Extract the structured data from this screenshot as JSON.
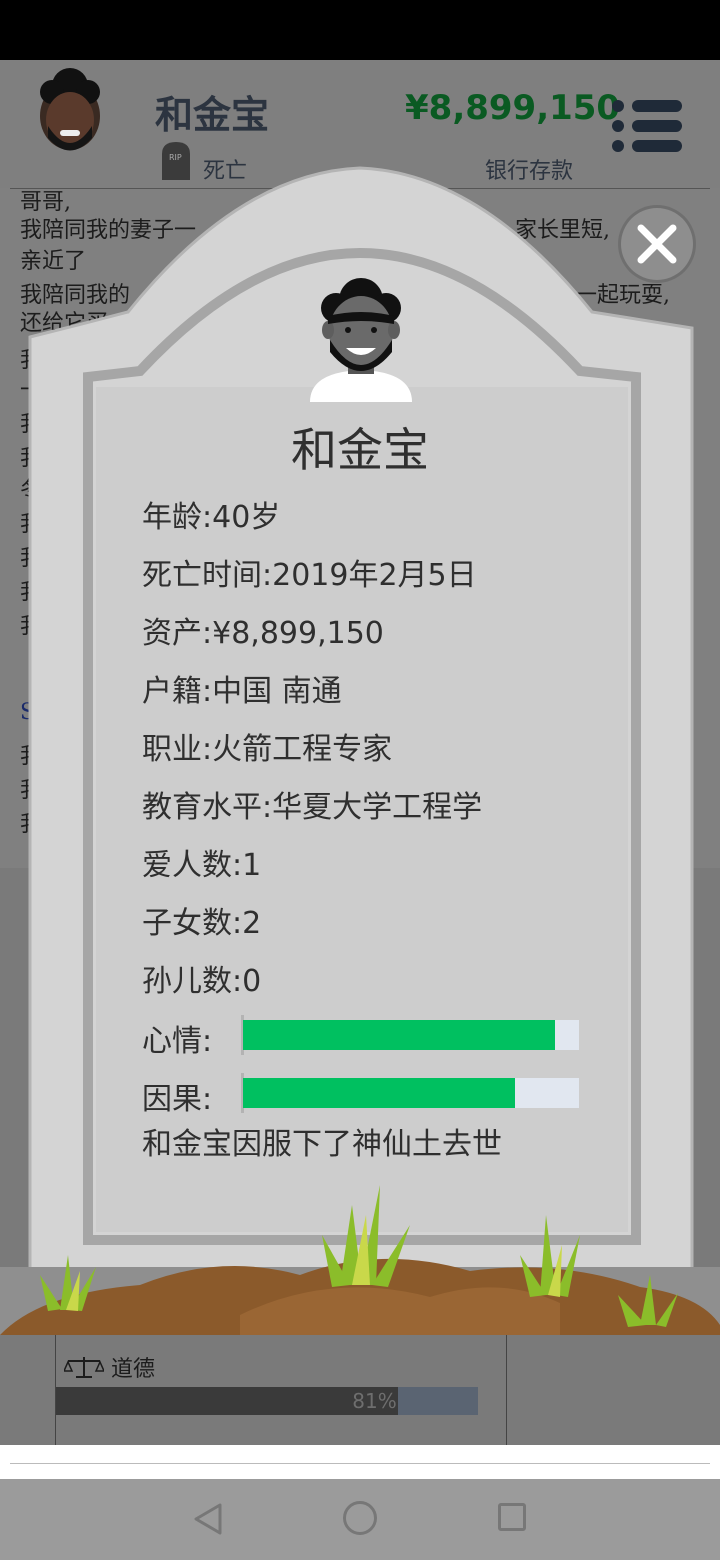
{
  "header": {
    "name": "和金宝",
    "status": "死亡",
    "money": "¥8,899,150",
    "money_label": "银行存款"
  },
  "log": [
    "哥哥,",
    "我陪同我的妻子一",
    "家长里短,",
    "亲近了",
    "我陪同我的",
    "一起玩耍,",
    "还给它买",
    "我",
    "一",
    "我",
    "我",
    "冬",
    "我",
    "我",
    "我",
    "我",
    "S",
    "我",
    "我",
    "我"
  ],
  "moral": {
    "label": "道德",
    "percent_text": "81%",
    "value": 0.81
  },
  "tombstone": {
    "name": "和金宝",
    "rows": [
      {
        "label": "年龄:",
        "value": "40岁"
      },
      {
        "label": "死亡时间:",
        "value": "2019年2月5日"
      },
      {
        "label": "资产:",
        "value": "¥8,899,150"
      },
      {
        "label": "户籍:",
        "value": "中国 南通"
      },
      {
        "label": "职业:",
        "value": "火箭工程专家"
      },
      {
        "label": "教育水平:",
        "value": "华夏大学工程学"
      },
      {
        "label": "爱人数:",
        "value": "1"
      },
      {
        "label": "子女数:",
        "value": "2"
      },
      {
        "label": "孙儿数:",
        "value": "0"
      }
    ],
    "mood": {
      "label": "心情:",
      "value": 0.93
    },
    "karma": {
      "label": "因果:",
      "value": 0.81
    },
    "epitaph": "和金宝因服下了神仙土去世"
  },
  "colors": {
    "meter_fill": "#00c060",
    "meter_track": "#e1e7f0",
    "money": "#0a5a22"
  }
}
